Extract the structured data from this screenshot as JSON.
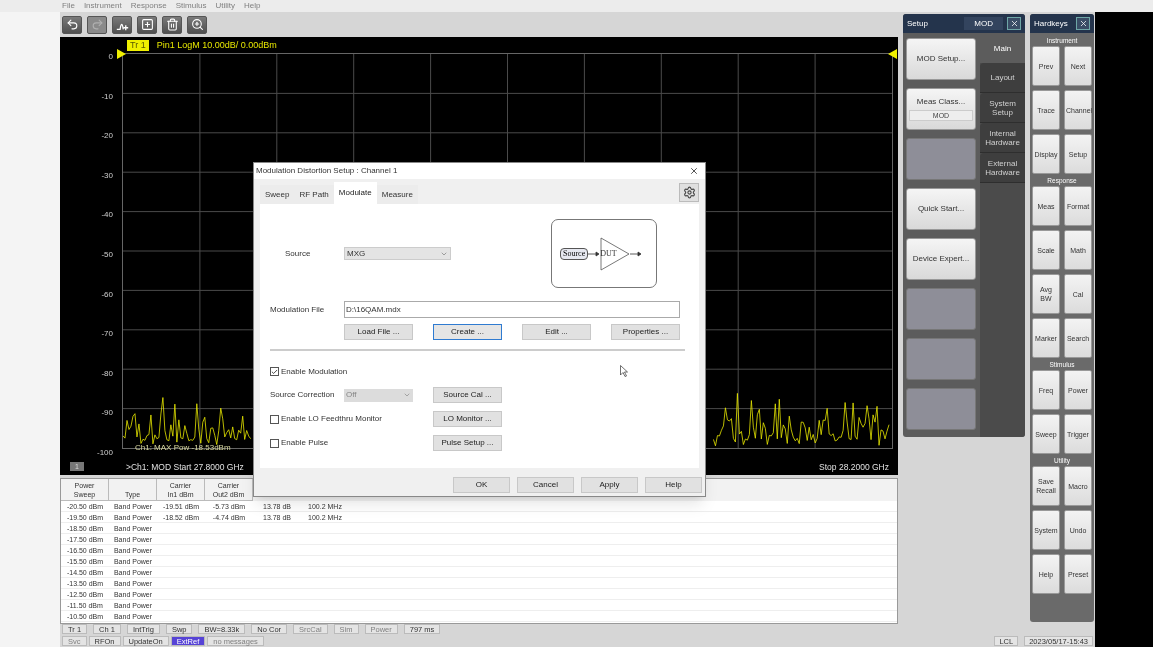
{
  "menu": [
    "File",
    "Instrument",
    "Response",
    "Stimulus",
    "Utility",
    "Help"
  ],
  "toolbar": [
    {
      "kind": "undo",
      "disabled": false
    },
    {
      "kind": "redo",
      "disabled": true
    },
    {
      "kind": "add-marker",
      "disabled": false
    },
    {
      "kind": "add-window",
      "disabled": false
    },
    {
      "kind": "delete",
      "disabled": false
    },
    {
      "kind": "zoom",
      "disabled": false
    }
  ],
  "trace": {
    "badge": "Tr 1",
    "label": "Pin1 LogM 10.00dB/  0.00dBm"
  },
  "chart": {
    "y_labels": [
      "0",
      "-10",
      "-20",
      "-30",
      "-40",
      "-50",
      "-60",
      "-70",
      "-80",
      "-90",
      "-100"
    ],
    "readout": "Ch1: MAX Pow -18.53dBm",
    "channel_badge": "1",
    "start": ">Ch1: MOD  Start  27.8000 GHz",
    "stop": "Stop  28.2000 GHz"
  },
  "table": {
    "columns": [
      {
        "heading": [
          "Power",
          "Sweep"
        ]
      },
      {
        "heading": [
          "Type"
        ]
      },
      {
        "heading": [
          "Carrier",
          "In1 dBm"
        ]
      },
      {
        "heading": [
          "Carrier",
          "Out2 dBm"
        ]
      }
    ],
    "rows": [
      [
        "-20.50 dBm",
        "Band Power",
        "-19.51 dBm",
        "-5.73 dBm",
        "13.78 dB",
        "100.2 MHz"
      ],
      [
        "-19.50 dBm",
        "Band Power",
        "-18.52 dBm",
        "-4.74 dBm",
        "13.78 dB",
        "100.2 MHz"
      ],
      [
        "-18.50 dBm",
        "Band Power"
      ],
      [
        "-17.50 dBm",
        "Band Power"
      ],
      [
        "-16.50 dBm",
        "Band Power"
      ],
      [
        "-15.50 dBm",
        "Band Power"
      ],
      [
        "-14.50 dBm",
        "Band Power"
      ],
      [
        "-13.50 dBm",
        "Band Power"
      ],
      [
        "-12.50 dBm",
        "Band Power"
      ],
      [
        "-11.50 dBm",
        "Band Power"
      ],
      [
        "-10.50 dBm",
        "Band Power"
      ]
    ]
  },
  "status_bar": {
    "row_1": [
      {
        "label": "Tr 1",
        "disabled": false
      },
      {
        "label": "Ch 1",
        "disabled": false
      },
      {
        "label": "IntTrig",
        "disabled": false
      },
      {
        "label": "Swp",
        "disabled": false
      },
      {
        "label": "BW=8.33k",
        "disabled": false
      },
      {
        "label": "No Cor",
        "disabled": false
      },
      {
        "label": "SrcCal",
        "disabled": true
      },
      {
        "label": "Sim",
        "disabled": true
      },
      {
        "label": "Power",
        "disabled": true
      },
      {
        "label": "797 ms",
        "disabled": false
      }
    ],
    "row_2": [
      {
        "label": "Svc",
        "disabled": true,
        "highlighted": false
      },
      {
        "label": "RFOn",
        "disabled": false,
        "highlighted": false
      },
      {
        "label": "UpdateOn",
        "disabled": false,
        "highlighted": false
      },
      {
        "label": "ExtRef",
        "disabled": false,
        "highlighted": true
      },
      {
        "label": "no messages",
        "disabled": true,
        "highlighted": false
      }
    ],
    "right": [
      "LCL",
      "2023/05/17-15:43"
    ]
  },
  "setup_panel": {
    "title": "Setup",
    "mode": "MOD",
    "buttons": [
      {
        "kind": "key",
        "label": "MOD Setup..."
      },
      {
        "kind": "key",
        "label": "Meas Class...",
        "sub": "MOD"
      },
      {
        "kind": "blank"
      },
      {
        "kind": "key",
        "label": "Quick Start..."
      },
      {
        "kind": "key",
        "label": "Device Expert..."
      },
      {
        "kind": "blank"
      },
      {
        "kind": "blank"
      },
      {
        "kind": "blank"
      }
    ],
    "tabs": [
      {
        "label": "Main",
        "selected": true
      },
      {
        "label": "Layout",
        "selected": false
      },
      {
        "label": "System Setup",
        "selected": false
      },
      {
        "label": "Internal Hardware",
        "selected": false
      },
      {
        "label": "External Hardware",
        "selected": false
      }
    ]
  },
  "hardkeys": {
    "title": "Hardkeys",
    "sections": [
      {
        "title": "Instrument",
        "keys": [
          "Prev",
          "Next",
          "Trace",
          "Channel",
          "Display",
          "Setup"
        ]
      },
      {
        "title": "Response",
        "keys": [
          "Meas",
          "Format",
          "Scale",
          "Math",
          "Avg BW",
          "Cal",
          "Marker",
          "Search"
        ]
      },
      {
        "title": "Stimulus",
        "keys": [
          "Freq",
          "Power",
          "Sweep",
          "Trigger"
        ]
      },
      {
        "title": "Utility",
        "keys": [
          "Save Recall",
          "Macro",
          "System",
          "Undo",
          "Help",
          "Preset"
        ]
      }
    ]
  },
  "dialog": {
    "title": "Modulation Distortion Setup : Channel 1",
    "tabs": [
      {
        "label": "Sweep",
        "selected": false
      },
      {
        "label": "RF Path",
        "selected": false
      },
      {
        "label": "Modulate",
        "selected": true
      },
      {
        "label": "Measure",
        "selected": false
      }
    ],
    "source": {
      "label": "Source",
      "value": "MXG"
    },
    "diagram": {
      "source": "Source",
      "dut": "DUT"
    },
    "modulation_file": {
      "label": "Modulation File",
      "value": "D:\\16QAM.mdx"
    },
    "file_buttons": [
      {
        "label": "Load File ...",
        "focused": false
      },
      {
        "label": "Create ...",
        "focused": true
      },
      {
        "label": "Edit ...",
        "focused": false
      },
      {
        "label": "Properties ...",
        "focused": false
      }
    ],
    "options": [
      {
        "kind": "checkbox",
        "label": "Enable Modulation",
        "checked": true
      },
      {
        "kind": "select",
        "label": "Source Correction",
        "value": "Off",
        "disabled": true,
        "button": "Source Cal ..."
      },
      {
        "kind": "checkbox",
        "label": "Enable LO Feedthru Monitor",
        "checked": false,
        "button": "LO Monitor ..."
      },
      {
        "kind": "checkbox",
        "label": "Enable Pulse",
        "checked": false,
        "button": "Pulse Setup ..."
      }
    ],
    "footer_buttons": [
      "OK",
      "Cancel",
      "Apply",
      "Help"
    ]
  }
}
